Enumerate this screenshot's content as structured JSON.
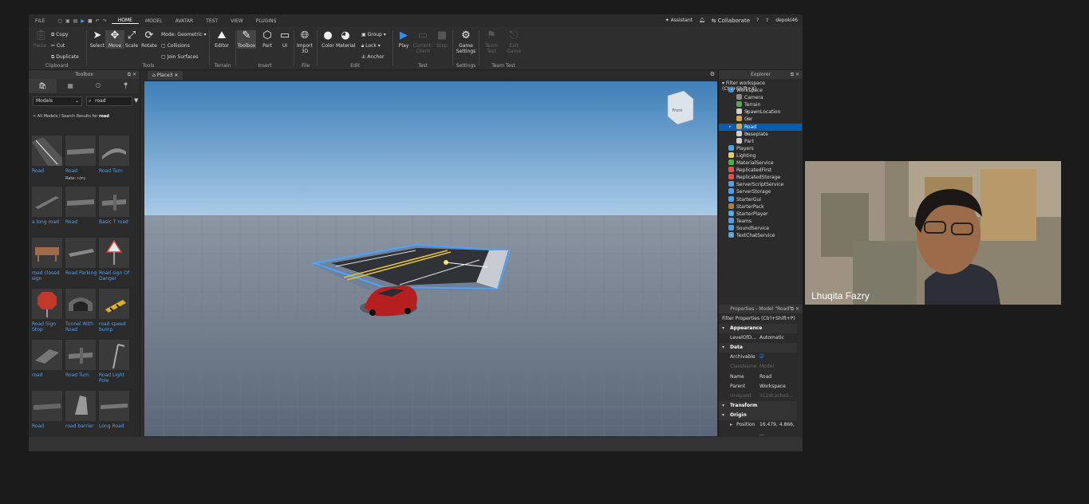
{
  "menubar": {
    "file": "FILE",
    "tabs": [
      "HOME",
      "MODEL",
      "AVATAR",
      "TEST",
      "VIEW",
      "PLUGINS"
    ],
    "assistant": "Assistant",
    "collaborate": "Collaborate",
    "user": "depoki46"
  },
  "ribbon": {
    "clipboard": {
      "paste": "Paste",
      "copy": "Copy",
      "cut": "Cut",
      "duplicate": "Duplicate",
      "label": "Clipboard"
    },
    "tools": {
      "select": "Select",
      "move": "Move",
      "scale": "Scale",
      "rotate": "Rotate",
      "mode_label": "Mode:",
      "mode_value": "Geometric",
      "collisions": "Collisions",
      "join_surfaces": "Join Surfaces",
      "label": "Tools"
    },
    "terrain": {
      "editor": "Editor",
      "label": "Terrain"
    },
    "insert": {
      "toolbox": "Toolbox",
      "part": "Part",
      "ui": "UI",
      "label": "Insert"
    },
    "file": {
      "import3d": "Import 3D",
      "label": "File"
    },
    "edit": {
      "color": "Color",
      "material": "Material",
      "group": "Group",
      "lock": "Lock",
      "anchor": "Anchor",
      "label": "Edit"
    },
    "test": {
      "play": "Play",
      "current_client": "Current: Client",
      "stop": "Stop",
      "label": "Test"
    },
    "settings": {
      "game_settings": "Game Settings",
      "label": "Settings"
    },
    "team_test": {
      "team_test": "Team Test",
      "exit_game": "Exit Game",
      "label": "Team Test"
    }
  },
  "toolbox": {
    "title": "Toolbox",
    "category": "Models",
    "search_value": "road",
    "breadcrumb_prefix": "< All Models / Search Results for",
    "breadcrumb_term": "road",
    "rate_label": "Rate:",
    "items": [
      {
        "label": "Road"
      },
      {
        "label": "Road"
      },
      {
        "label": "Road Turn"
      },
      {
        "label": "a long road"
      },
      {
        "label": "Road"
      },
      {
        "label": "Basic T road"
      },
      {
        "label": "road closed sign"
      },
      {
        "label": "Road Parking"
      },
      {
        "label": "Road sign Of Danger"
      },
      {
        "label": "Road Sign Stop"
      },
      {
        "label": "Tunnel With Road"
      },
      {
        "label": "road speed bump"
      },
      {
        "label": "road"
      },
      {
        "label": "Road Turn"
      },
      {
        "label": "Road Light Pole"
      },
      {
        "label": "Road"
      },
      {
        "label": "road barrier"
      },
      {
        "label": "Long Road"
      }
    ]
  },
  "viewport": {
    "tab": "Place3",
    "cube_label": "Front"
  },
  "explorer": {
    "title": "Explorer",
    "filter": "Filter workspace (Ctrl+Shift+X)",
    "nodes": [
      {
        "label": "Workspace",
        "depth": 0,
        "expanded": true,
        "color": "#3b8fd6"
      },
      {
        "label": "Camera",
        "depth": 1,
        "color": "#8a8a8a"
      },
      {
        "label": "Terrain",
        "depth": 1,
        "color": "#4caf50"
      },
      {
        "label": "SpawnLocation",
        "depth": 1,
        "color": "#cfcfcf",
        "collapsed": true
      },
      {
        "label": "Car",
        "depth": 1,
        "color": "#e0a23a",
        "collapsed": true
      },
      {
        "label": "Road",
        "depth": 1,
        "color": "#e0a23a",
        "collapsed": true,
        "selected": true
      },
      {
        "label": "Baseplate",
        "depth": 1,
        "color": "#cfcfcf",
        "collapsed": true
      },
      {
        "label": "Part",
        "depth": 1,
        "color": "#cfcfcf"
      },
      {
        "label": "Players",
        "depth": 0,
        "color": "#4ca3e8"
      },
      {
        "label": "Lighting",
        "depth": 0,
        "color": "#f3d04a",
        "collapsed": true
      },
      {
        "label": "MaterialService",
        "depth": 0,
        "color": "#4caf50"
      },
      {
        "label": "ReplicatedFirst",
        "depth": 0,
        "color": "#e05050"
      },
      {
        "label": "ReplicatedStorage",
        "depth": 0,
        "color": "#e05050"
      },
      {
        "label": "ServerScriptService",
        "depth": 0,
        "color": "#4ca3e8"
      },
      {
        "label": "ServerStorage",
        "depth": 0,
        "color": "#4ca3e8"
      },
      {
        "label": "StarterGui",
        "depth": 0,
        "color": "#4ca3e8"
      },
      {
        "label": "StarterPack",
        "depth": 0,
        "color": "#b07b3a"
      },
      {
        "label": "StarterPlayer",
        "depth": 0,
        "color": "#4ca3e8",
        "collapsed": true
      },
      {
        "label": "Teams",
        "depth": 0,
        "color": "#4ca3e8"
      },
      {
        "label": "SoundService",
        "depth": 0,
        "color": "#4ca3e8"
      },
      {
        "label": "TextChatService",
        "depth": 0,
        "color": "#4ca3e8",
        "collapsed": true
      }
    ]
  },
  "properties": {
    "title": "Properties - Model \"Road\"",
    "filter": "Filter Properties (Ctrl+Shift+P)",
    "rows": [
      {
        "type": "cat",
        "key": "Appearance"
      },
      {
        "key": "LevelOfD...",
        "value": "Automatic"
      },
      {
        "type": "cat",
        "key": "Data"
      },
      {
        "key": "Archivable",
        "value": "☑"
      },
      {
        "key": "ClassName",
        "value": "Model",
        "dim": true
      },
      {
        "key": "Name",
        "value": "Road"
      },
      {
        "key": "Parent",
        "value": "Workspace"
      },
      {
        "key": "UniqueId",
        "value": "312dcacbe5...",
        "dim": true
      },
      {
        "type": "cat",
        "key": "Transform"
      },
      {
        "type": "cat",
        "key": "Origin"
      },
      {
        "key": "Position",
        "value": "16.479, 4.866, ..."
      }
    ]
  },
  "video": {
    "name": "Lhuqita Fazry"
  }
}
